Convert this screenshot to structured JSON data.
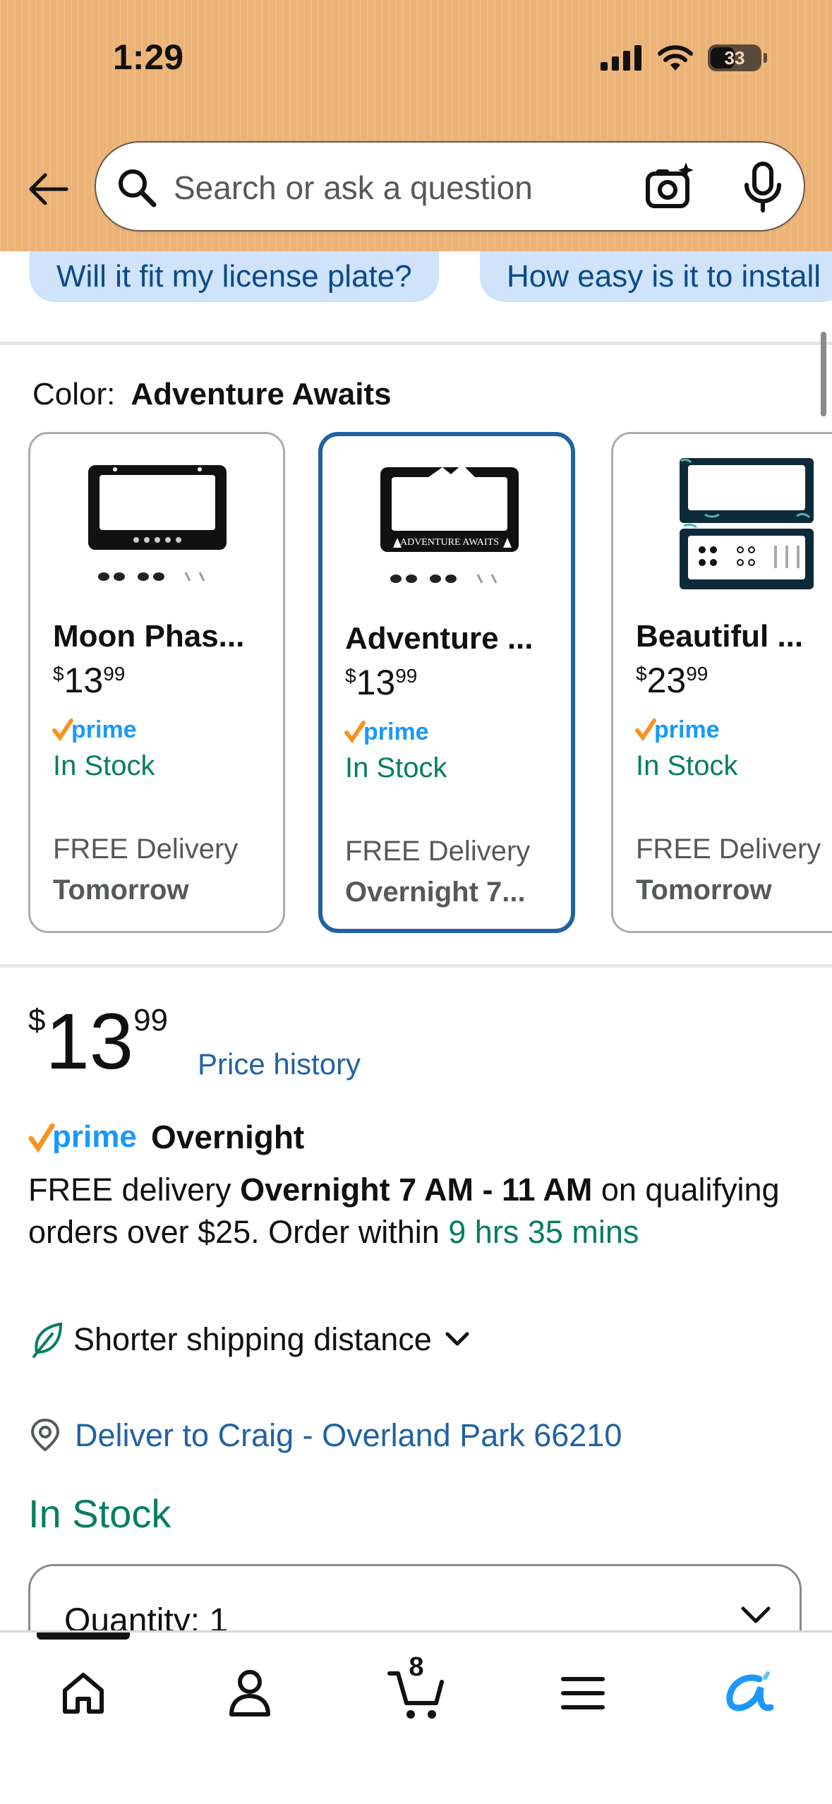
{
  "status_bar": {
    "time": "1:29",
    "battery": "33"
  },
  "search": {
    "placeholder": "Search or ask a question"
  },
  "chips": [
    {
      "label": "Will it fit my license plate?"
    },
    {
      "label": "How easy is it to install"
    }
  ],
  "color": {
    "label": "Color:",
    "value": "Adventure Awaits"
  },
  "variants": [
    {
      "name": "Moon Phas...",
      "price_whole": "13",
      "price_cents": "99",
      "currency": "$",
      "stock": "In Stock",
      "delivery_label": "FREE Delivery",
      "delivery_when": "Tomorrow",
      "selected": false
    },
    {
      "name": "Adventure ...",
      "price_whole": "13",
      "price_cents": "99",
      "currency": "$",
      "stock": "In Stock",
      "delivery_label": "FREE Delivery",
      "delivery_when": "Overnight 7...",
      "selected": true
    },
    {
      "name": "Beautiful ...",
      "price_whole": "23",
      "price_cents": "99",
      "currency": "$",
      "stock": "In Stock",
      "delivery_label": "FREE Delivery",
      "delivery_when": "Tomorrow",
      "selected": false
    }
  ],
  "price": {
    "currency": "$",
    "whole": "13",
    "cents": "99",
    "history_link": "Price history"
  },
  "prime": {
    "word": "prime",
    "service": "Overnight"
  },
  "delivery": {
    "prefix": "FREE delivery ",
    "window": "Overnight 7 AM - 11 AM",
    "middle": " on qualifying orders over $25. Order within ",
    "countdown": "9 hrs 35 mins"
  },
  "shipping": {
    "label": "Shorter shipping distance"
  },
  "location": {
    "label": "Deliver to Craig - Overland Park 66210"
  },
  "availability": {
    "label": "In Stock"
  },
  "quantity": {
    "label": "Quantity:",
    "value": "1"
  },
  "nav": {
    "cart_count": "8"
  },
  "colors": {
    "header": "#efb679",
    "link": "#2162a1",
    "stock_green": "#067d62",
    "prime_blue": "#1a98ff",
    "prime_check": "#f7931e",
    "chip_bg": "#cfe3fb"
  }
}
